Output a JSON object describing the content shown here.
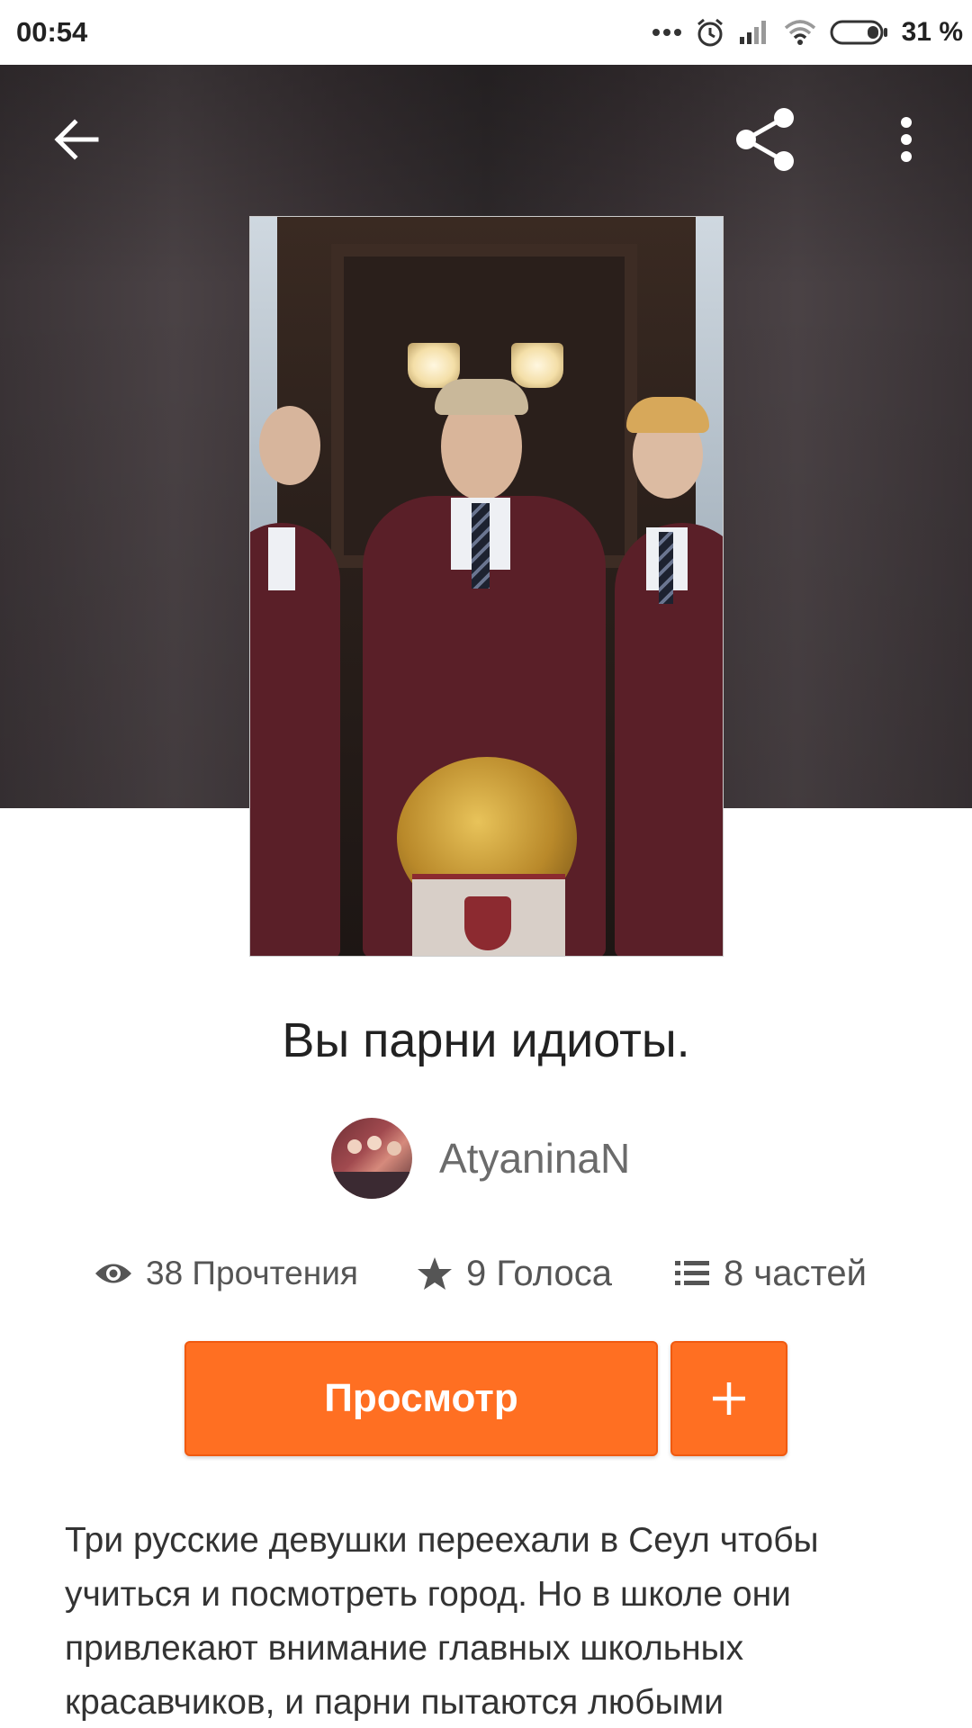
{
  "status_bar": {
    "time": "00:54",
    "battery_percent": "31 %",
    "icons": [
      "more-dots-icon",
      "alarm-icon",
      "signal-icon",
      "wifi-icon",
      "battery-icon"
    ]
  },
  "toolbar": {
    "back_icon": "arrow-left-icon",
    "share_icon": "share-icon",
    "more_icon": "more-vertical-icon"
  },
  "story": {
    "title": "Вы парни идиоты.",
    "author": "AtyaninaN",
    "stats": {
      "reads": "38 Прочтения",
      "votes": "9 Голоса",
      "parts": "8 частей"
    },
    "read_button": "Просмотр",
    "add_button": "+",
    "description": "Три русские девушки переехали в Сеул чтобы учиться и посмотреть город. Но в школе они привлекают внимание главных школьных красавчиков, и парни пытаются любыми"
  },
  "colors": {
    "accent": "#ff6f22",
    "header_bg": "#3a3336"
  }
}
